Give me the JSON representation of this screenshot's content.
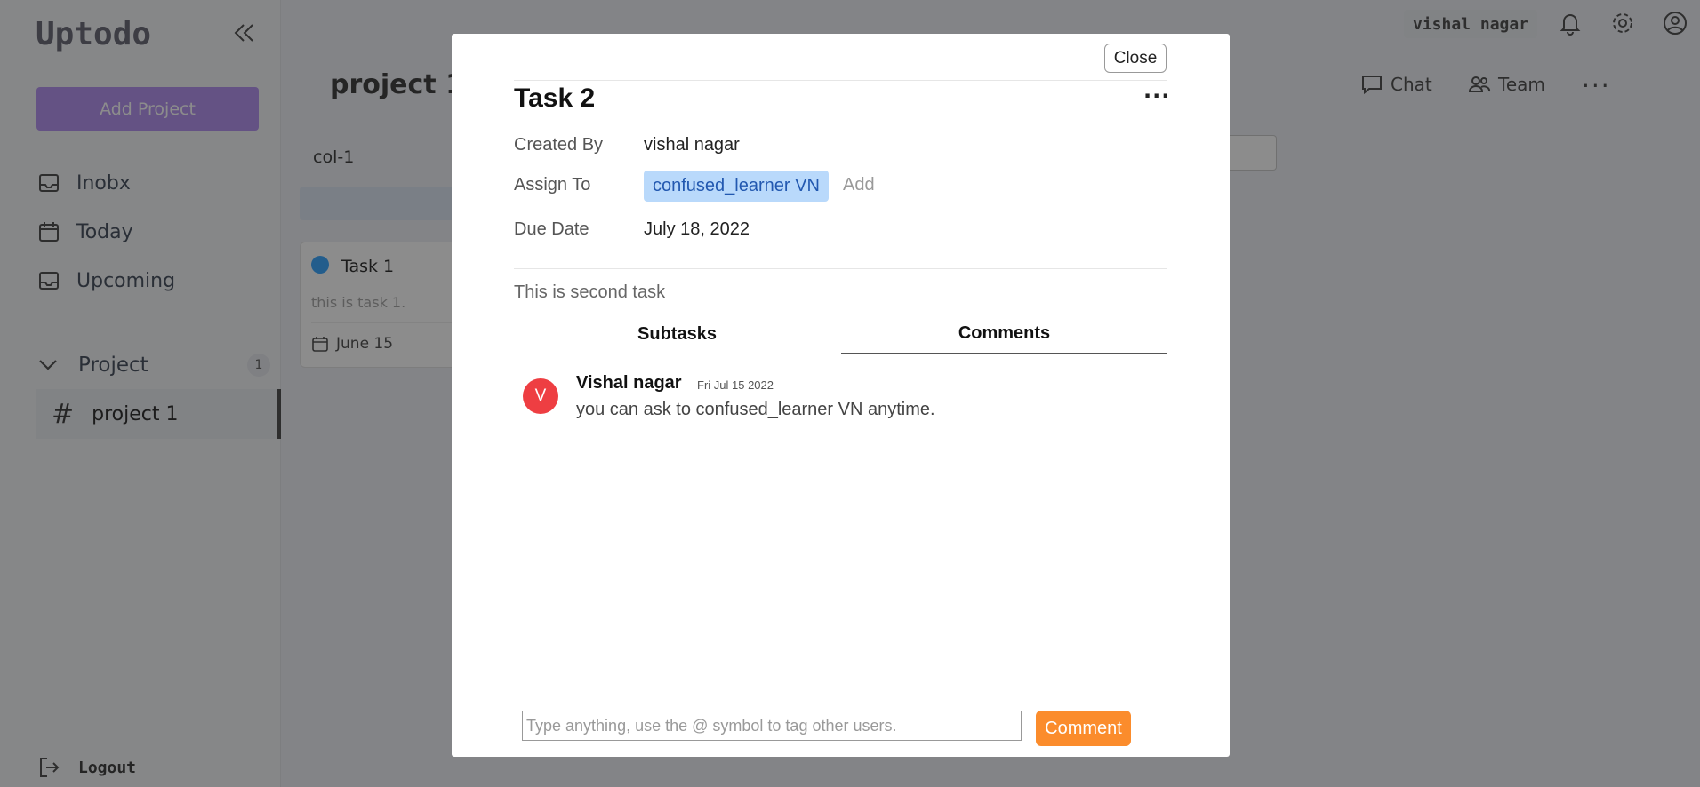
{
  "app": {
    "brand": "Uptodo",
    "add_project_label": "Add Project",
    "nav": [
      {
        "label": "Inobx",
        "icon": "inbox-icon"
      },
      {
        "label": "Today",
        "icon": "calendar-icon"
      },
      {
        "label": "Upcoming",
        "icon": "inbox-icon"
      }
    ],
    "projects_header": "Project",
    "projects_count": "1",
    "projects": [
      {
        "label": "project 1"
      }
    ],
    "logout_label": "Logout",
    "user_name": "vishal nagar"
  },
  "board": {
    "title": "project 1",
    "chat_label": "Chat",
    "team_label": "Team",
    "column_name": "col-1",
    "card": {
      "title": "Task 1",
      "description": "this is task 1.",
      "due": "June 15"
    }
  },
  "modal": {
    "close_label": "Close",
    "task_title": "Task 2",
    "more_label": "...",
    "created_by_label": "Created By",
    "created_by_value": "vishal nagar",
    "assign_to_label": "Assign To",
    "assignee": "confused_learner VN",
    "add_assignee_label": "Add",
    "due_date_label": "Due Date",
    "due_date_value": "July 18, 2022",
    "description": "This is second task",
    "tabs": [
      {
        "label": "Subtasks",
        "active": false
      },
      {
        "label": "Comments",
        "active": true
      }
    ],
    "comments": [
      {
        "avatar_letter": "V",
        "author": "Vishal nagar",
        "time": "Fri Jul 15 2022",
        "text": "you can ask to confused_learner VN anytime."
      }
    ],
    "comment_input": {
      "placeholder": "Type anything, use the @ symbol to tag other users.",
      "value": ""
    },
    "comment_button_label": "Comment"
  },
  "colors": {
    "accent": "#b695f1",
    "comment_button": "#fb8c2c",
    "avatar": "#ee3e42",
    "tag_bg": "#b9d9fb"
  }
}
